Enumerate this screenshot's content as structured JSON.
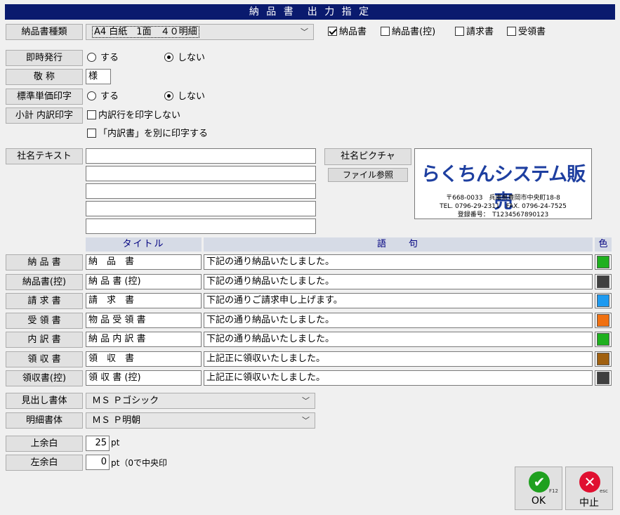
{
  "window_title": "納 品 書　出 力 指 定",
  "form_type": {
    "label": "納品書種類",
    "value": "A4 白紙　1面　４０明細",
    "checks": [
      {
        "label": "納品書",
        "checked": true
      },
      {
        "label": "納品書(控)",
        "checked": false
      },
      {
        "label": "請求書",
        "checked": false
      },
      {
        "label": "受領書",
        "checked": false
      }
    ]
  },
  "immediate": {
    "label": "即時発行",
    "opt_yes": "する",
    "opt_no": "しない",
    "selected": "no"
  },
  "honorific": {
    "label": "敬 称",
    "value": "様"
  },
  "unit_price": {
    "label": "標準単価印字",
    "opt_yes": "する",
    "opt_no": "しない",
    "selected": "no"
  },
  "subtotal": {
    "label": "小計 内訳印字",
    "opt1": "内訳行を印字しない",
    "opt2": "「内訳書」を別に印字する"
  },
  "company_text": {
    "label": "社名テキスト",
    "lines": [
      "",
      "",
      "",
      "",
      ""
    ]
  },
  "company_picture": {
    "button_label": "社名ピクチャ",
    "browse_label": "ファイル参照",
    "logo_name": "らくちんシステム販売",
    "logo_address": "〒668-0033　兵庫県豊岡市中央町18-8",
    "logo_tel": "TEL. 0796-29-2311　FAX. 0796-24-7525",
    "logo_reg": "登録番号：　T1234567890123"
  },
  "table": {
    "col_title": "タイトル",
    "col_phrase": "語　　句",
    "col_color": "色",
    "rows": [
      {
        "label": "納 品 書",
        "title": "納　品　書",
        "phrase": "下記の通り納品いたしました。",
        "color": "#1fb01f"
      },
      {
        "label": "納品書(控)",
        "title": "納 品 書 (控)",
        "phrase": "下記の通り納品いたしました。",
        "color": "#404040"
      },
      {
        "label": "請 求 書",
        "title": "請　求　書",
        "phrase": "下記の通りご請求申し上げます。",
        "color": "#1e9af0"
      },
      {
        "label": "受 領 書",
        "title": "物 品 受 領 書",
        "phrase": "下記の通り納品いたしました。",
        "color": "#f07010"
      },
      {
        "label": "内 訳 書",
        "title": "納 品 内 訳 書",
        "phrase": "下記の通り納品いたしました。",
        "color": "#1fb01f"
      },
      {
        "label": "領 収 書",
        "title": "領　収　書",
        "phrase": "上記正に領収いたしました。",
        "color": "#a06010"
      },
      {
        "label": "領収書(控)",
        "title": "領 収 書 (控)",
        "phrase": "上記正に領収いたしました。",
        "color": "#404040"
      }
    ]
  },
  "heading_font": {
    "label": "見出し書体",
    "value": "ＭＳ Ｐゴシック"
  },
  "detail_font": {
    "label": "明細書体",
    "value": "ＭＳ Ｐ明朝"
  },
  "top_margin": {
    "label": "上余白",
    "value": "25",
    "unit": "pt"
  },
  "left_margin": {
    "label": "左余白",
    "value": "0",
    "unit": "pt（0で中央印"
  },
  "ok_button": {
    "label": "OK",
    "key": "F12"
  },
  "cancel_button": {
    "label": "中止",
    "key": "esc"
  }
}
